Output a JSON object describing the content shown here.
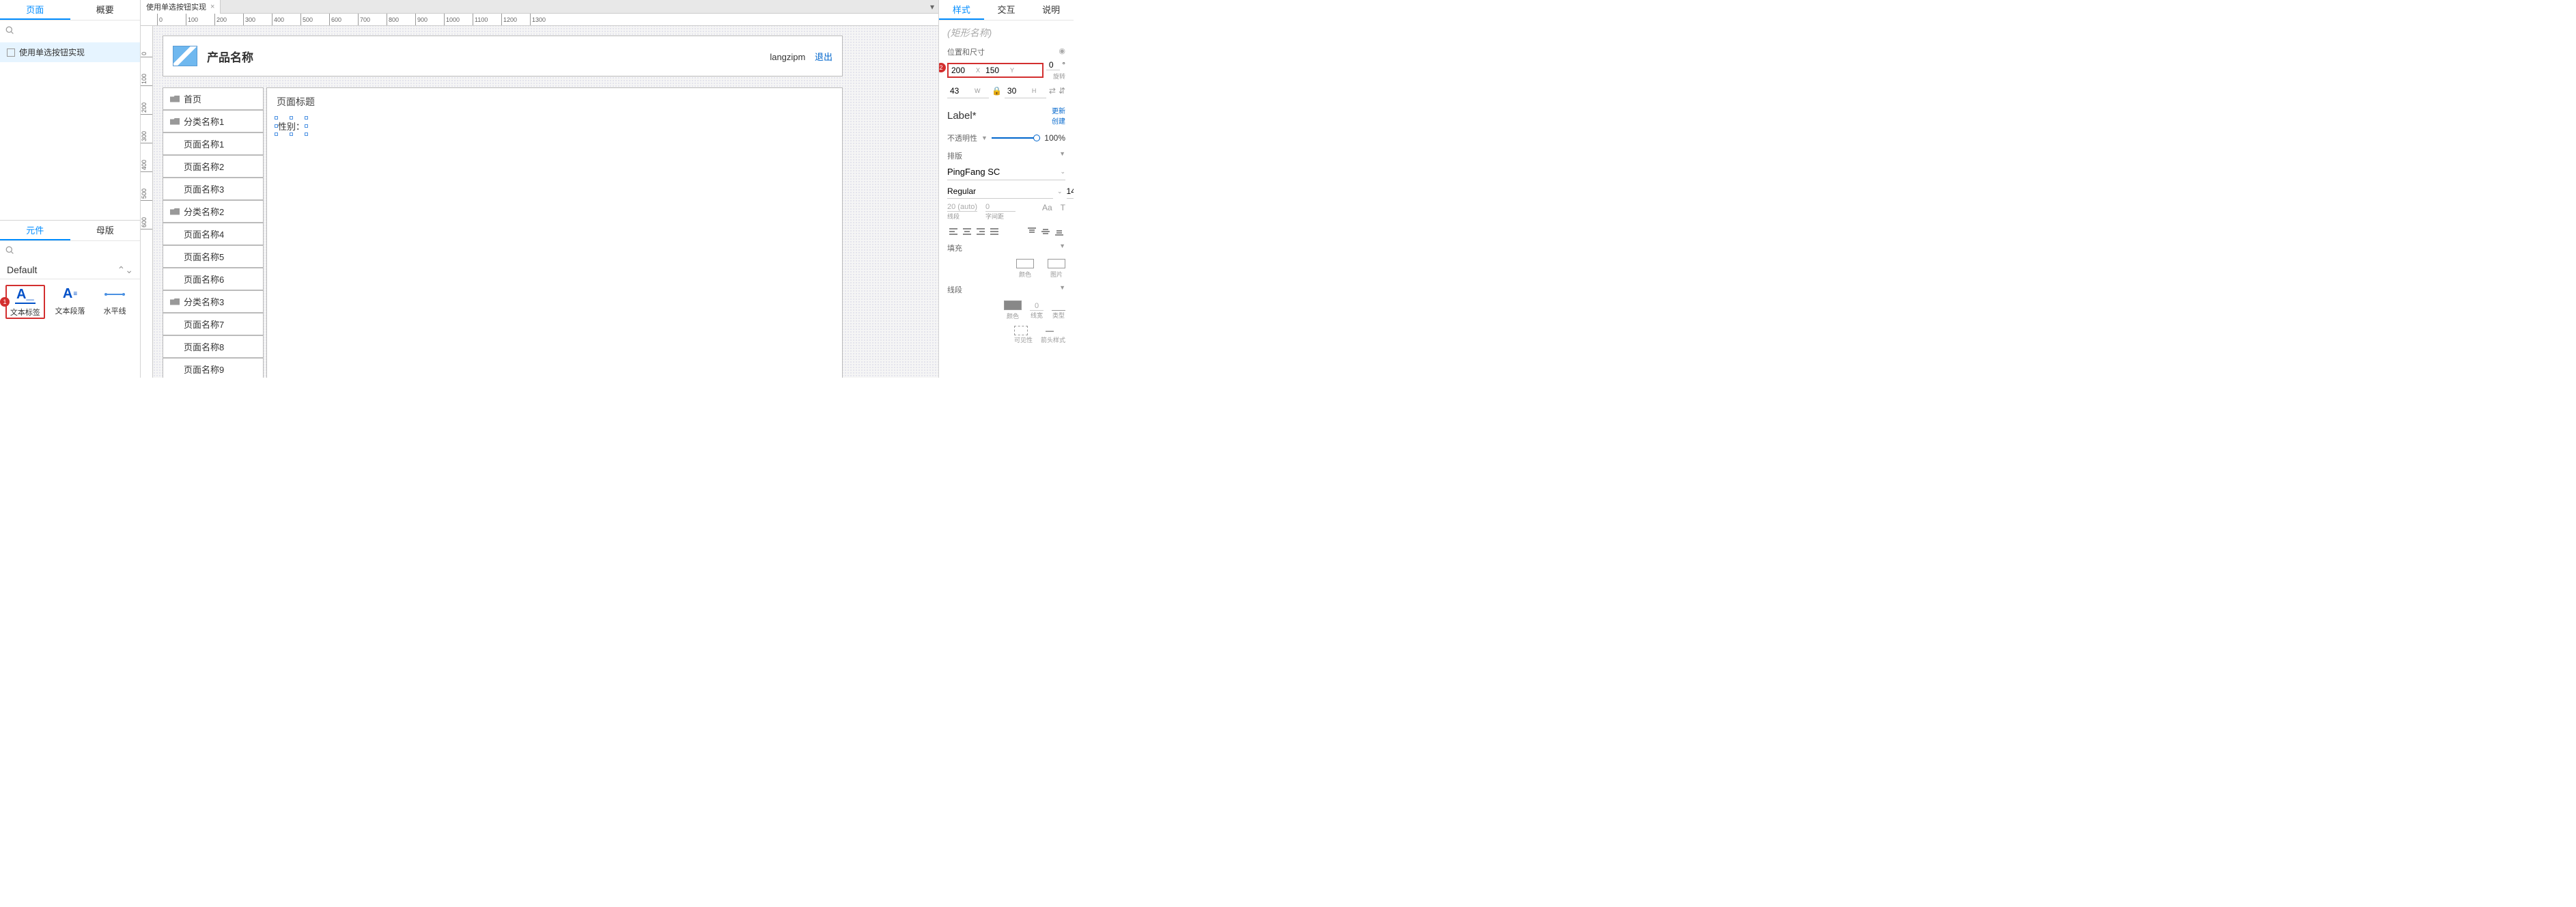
{
  "left": {
    "tabs": {
      "pages": "页面",
      "overview": "概要"
    },
    "search_placeholder": "",
    "tree_item": "使用单选按钮实现"
  },
  "elements": {
    "tabs": {
      "components": "元件",
      "masters": "母版"
    },
    "library": "Default",
    "widgets": {
      "text_label": "文本标签",
      "text_paragraph": "文本段落",
      "hr": "水平线"
    },
    "badge1": "1"
  },
  "center": {
    "filetab": "使用单选按钮实现",
    "ruler_h": [
      "0",
      "100",
      "200",
      "300",
      "400",
      "500",
      "600",
      "700",
      "800",
      "900",
      "1000",
      "1100",
      "1200",
      "1300"
    ],
    "ruler_v": [
      "0",
      "100",
      "200",
      "300",
      "400",
      "500",
      "600"
    ],
    "mock": {
      "product_name": "产品名称",
      "username": "langzipm",
      "logout": "退出",
      "nav": [
        "首页",
        "分类名称1",
        "页面名称1",
        "页面名称2",
        "页面名称3",
        "分类名称2",
        "页面名称4",
        "页面名称5",
        "页面名称6",
        "分类名称3",
        "页面名称7",
        "页面名称8",
        "页面名称9"
      ],
      "page_title": "页面标题",
      "selected_text": "性别："
    }
  },
  "right": {
    "tabs": {
      "style": "样式",
      "interact": "交互",
      "notes": "说明"
    },
    "shape_name_placeholder": "(矩形名称)",
    "sections": {
      "pos_size": "位置和尺寸",
      "opacity": "不透明性",
      "typography": "排版",
      "fill": "填充",
      "line": "线段"
    },
    "pos": {
      "x": "200",
      "x_label": "X",
      "y": "150",
      "y_label": "Y",
      "rot": "0",
      "rot_unit": "°",
      "rot_label": "旋转"
    },
    "size": {
      "w": "43",
      "w_label": "W",
      "h": "30",
      "h_label": "H"
    },
    "label": "Label*",
    "update_create": {
      "update": "更新",
      "create": "创建"
    },
    "opacity_val": "100%",
    "font": "PingFang SC",
    "font_weight": "Regular",
    "font_size": "14",
    "line_height": "20 (auto)",
    "line_height_label": "线段",
    "letter_spacing": "0",
    "letter_spacing_label": "字间距",
    "fill_color": "颜色",
    "fill_image": "图片",
    "line_val": "0",
    "line_color": "颜色",
    "line_width": "线宽",
    "line_type": "类型",
    "visibility": "可见性",
    "arrow_style": "箭头样式",
    "badge2": "2"
  }
}
